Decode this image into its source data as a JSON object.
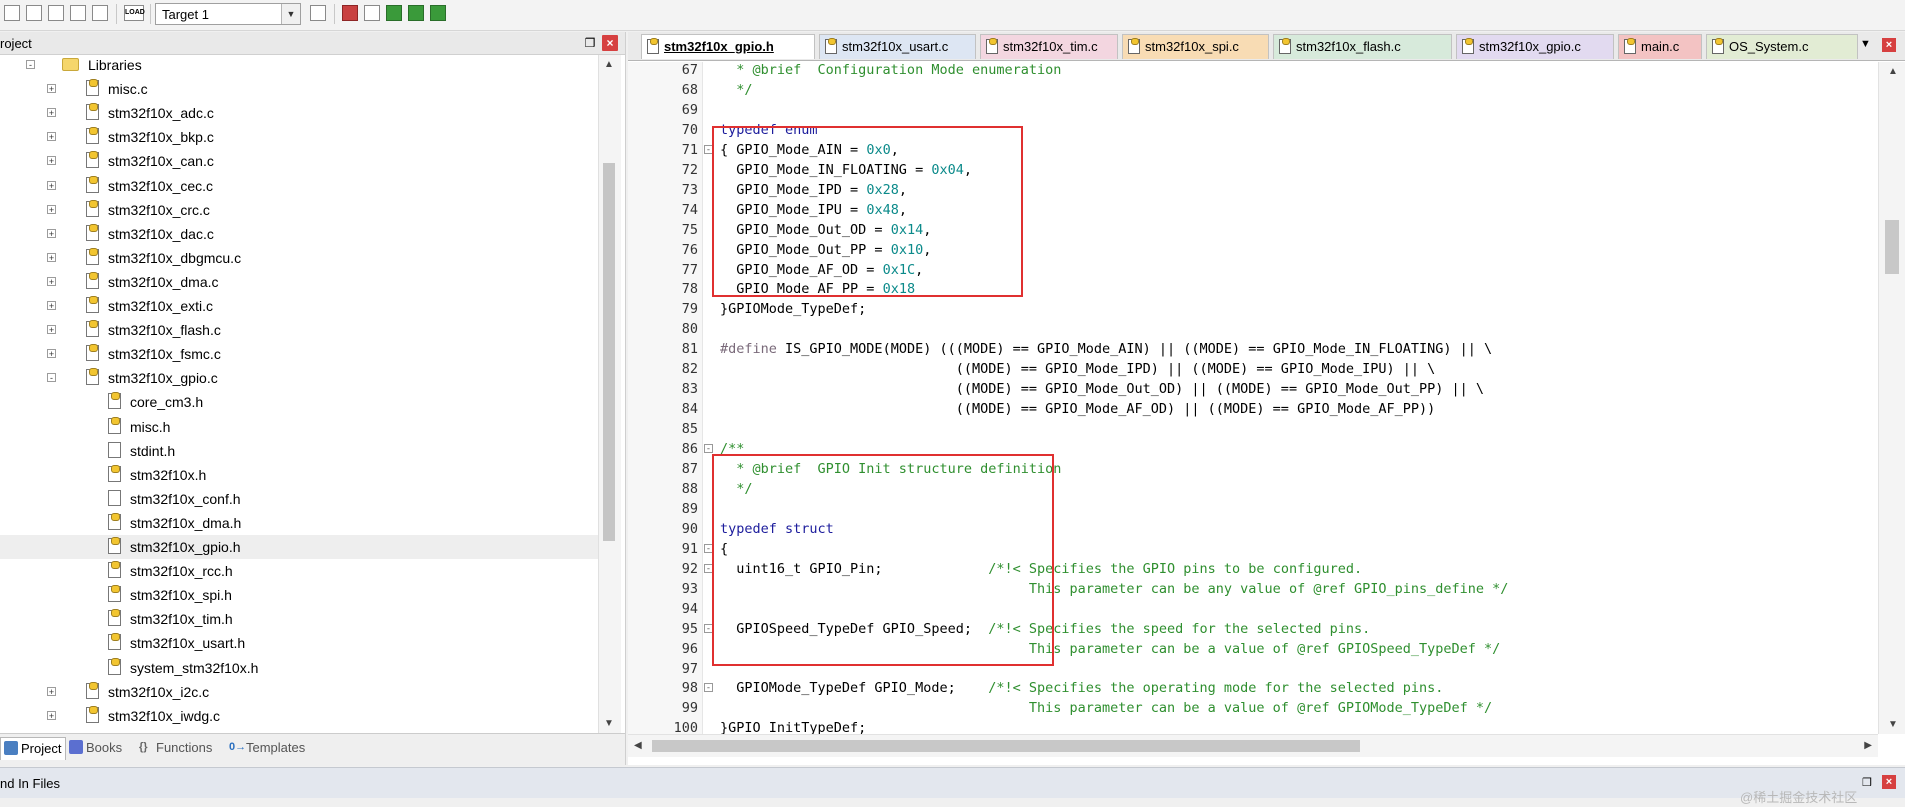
{
  "toolbar": {
    "target_label": "Target 1",
    "load_label": "LOAD"
  },
  "left_panel": {
    "title": "roject",
    "pin_glyph": "❒",
    "close_glyph": "×",
    "tree": [
      {
        "label": "Libraries",
        "type": "folder",
        "expander": "-",
        "level": 0
      },
      {
        "label": "misc.c",
        "type": "c",
        "expander": "+",
        "level": 1
      },
      {
        "label": "stm32f10x_adc.c",
        "type": "c",
        "expander": "+",
        "level": 1
      },
      {
        "label": "stm32f10x_bkp.c",
        "type": "c",
        "expander": "+",
        "level": 1
      },
      {
        "label": "stm32f10x_can.c",
        "type": "c",
        "expander": "+",
        "level": 1
      },
      {
        "label": "stm32f10x_cec.c",
        "type": "c",
        "expander": "+",
        "level": 1
      },
      {
        "label": "stm32f10x_crc.c",
        "type": "c",
        "expander": "+",
        "level": 1
      },
      {
        "label": "stm32f10x_dac.c",
        "type": "c",
        "expander": "+",
        "level": 1
      },
      {
        "label": "stm32f10x_dbgmcu.c",
        "type": "c",
        "expander": "+",
        "level": 1
      },
      {
        "label": "stm32f10x_dma.c",
        "type": "c",
        "expander": "+",
        "level": 1
      },
      {
        "label": "stm32f10x_exti.c",
        "type": "c",
        "expander": "+",
        "level": 1
      },
      {
        "label": "stm32f10x_flash.c",
        "type": "c",
        "expander": "+",
        "level": 1
      },
      {
        "label": "stm32f10x_fsmc.c",
        "type": "c",
        "expander": "+",
        "level": 1
      },
      {
        "label": "stm32f10x_gpio.c",
        "type": "c",
        "expander": "-",
        "level": 1
      },
      {
        "label": "core_cm3.h",
        "type": "c",
        "expander": "",
        "level": 2
      },
      {
        "label": "misc.h",
        "type": "c",
        "expander": "",
        "level": 2
      },
      {
        "label": "stdint.h",
        "type": "h",
        "expander": "",
        "level": 2
      },
      {
        "label": "stm32f10x.h",
        "type": "c",
        "expander": "",
        "level": 2
      },
      {
        "label": "stm32f10x_conf.h",
        "type": "h",
        "expander": "",
        "level": 2
      },
      {
        "label": "stm32f10x_dma.h",
        "type": "c",
        "expander": "",
        "level": 2
      },
      {
        "label": "stm32f10x_gpio.h",
        "type": "c",
        "expander": "",
        "level": 2,
        "selected": true
      },
      {
        "label": "stm32f10x_rcc.h",
        "type": "c",
        "expander": "",
        "level": 2
      },
      {
        "label": "stm32f10x_spi.h",
        "type": "c",
        "expander": "",
        "level": 2
      },
      {
        "label": "stm32f10x_tim.h",
        "type": "c",
        "expander": "",
        "level": 2
      },
      {
        "label": "stm32f10x_usart.h",
        "type": "c",
        "expander": "",
        "level": 2
      },
      {
        "label": "system_stm32f10x.h",
        "type": "c",
        "expander": "",
        "level": 2
      },
      {
        "label": "stm32f10x_i2c.c",
        "type": "c",
        "expander": "+",
        "level": 1
      },
      {
        "label": "stm32f10x_iwdg.c",
        "type": "c",
        "expander": "+",
        "level": 1
      }
    ],
    "bottom_tabs": [
      {
        "label": "Project",
        "icon_color": "#4a7fc1"
      },
      {
        "label": "Books",
        "icon_color": "#5b6fd0"
      },
      {
        "label": "Functions",
        "icon_color": "#666666",
        "glyph": "{}"
      },
      {
        "label": "Templates",
        "icon_color": "#2a6fbf",
        "glyph": "0→"
      }
    ]
  },
  "editor": {
    "tabs": [
      {
        "label": "stm32f10x_gpio.h",
        "active": true,
        "color": "#ffffff"
      },
      {
        "label": "stm32f10x_usart.c",
        "color": "#dde6f3"
      },
      {
        "label": "stm32f10x_tim.c",
        "color": "#f3d6e0"
      },
      {
        "label": "stm32f10x_spi.c",
        "color": "#f8dcb4"
      },
      {
        "label": "stm32f10x_flash.c",
        "color": "#d7eadb"
      },
      {
        "label": "stm32f10x_gpio.c",
        "color": "#e2daf0"
      },
      {
        "label": "main.c",
        "color": "#f3c3c3"
      },
      {
        "label": "OS_System.c",
        "color": "#e2ecd4"
      }
    ],
    "menu_glyph": "▼",
    "close_glyph": "×",
    "lines": [
      {
        "n": "67",
        "fold": "",
        "segs": [
          [
            "cm",
            "  * @brief  Configuration Mode enumeration"
          ]
        ]
      },
      {
        "n": "68",
        "fold": "",
        "segs": [
          [
            "cm",
            "  */"
          ]
        ]
      },
      {
        "n": "69",
        "fold": "",
        "segs": []
      },
      {
        "n": "70",
        "fold": "",
        "segs": [
          [
            "kw",
            "typedef enum"
          ]
        ]
      },
      {
        "n": "71",
        "fold": "-",
        "segs": [
          [
            "plain",
            "{ GPIO_Mode_AIN = "
          ],
          [
            "num",
            "0x0"
          ],
          [
            "plain",
            ","
          ]
        ]
      },
      {
        "n": "72",
        "fold": "",
        "segs": [
          [
            "plain",
            "  GPIO_Mode_IN_FLOATING = "
          ],
          [
            "num",
            "0x04"
          ],
          [
            "plain",
            ","
          ]
        ]
      },
      {
        "n": "73",
        "fold": "",
        "segs": [
          [
            "plain",
            "  GPIO_Mode_IPD = "
          ],
          [
            "num",
            "0x28"
          ],
          [
            "plain",
            ","
          ]
        ]
      },
      {
        "n": "74",
        "fold": "",
        "segs": [
          [
            "plain",
            "  GPIO_Mode_IPU = "
          ],
          [
            "num",
            "0x48"
          ],
          [
            "plain",
            ","
          ]
        ]
      },
      {
        "n": "75",
        "fold": "",
        "segs": [
          [
            "plain",
            "  GPIO_Mode_Out_OD = "
          ],
          [
            "num",
            "0x14"
          ],
          [
            "plain",
            ","
          ]
        ]
      },
      {
        "n": "76",
        "fold": "",
        "segs": [
          [
            "plain",
            "  GPIO_Mode_Out_PP = "
          ],
          [
            "num",
            "0x10"
          ],
          [
            "plain",
            ","
          ]
        ]
      },
      {
        "n": "77",
        "fold": "",
        "segs": [
          [
            "plain",
            "  GPIO_Mode_AF_OD = "
          ],
          [
            "num",
            "0x1C"
          ],
          [
            "plain",
            ","
          ]
        ]
      },
      {
        "n": "78",
        "fold": "",
        "segs": [
          [
            "plain",
            "  GPIO_Mode_AF_PP = "
          ],
          [
            "num",
            "0x18"
          ]
        ]
      },
      {
        "n": "79",
        "fold": "",
        "segs": [
          [
            "plain",
            "}GPIOMode_TypeDef;"
          ]
        ]
      },
      {
        "n": "80",
        "fold": "",
        "segs": []
      },
      {
        "n": "81",
        "fold": "",
        "segs": [
          [
            "pp",
            "#define "
          ],
          [
            "plain",
            "IS_GPIO_MODE(MODE) (((MODE) == GPIO_Mode_AIN) || ((MODE) == GPIO_Mode_IN_FLOATING) || \\"
          ]
        ]
      },
      {
        "n": "82",
        "fold": "",
        "segs": [
          [
            "plain",
            "                             ((MODE) == GPIO_Mode_IPD) || ((MODE) == GPIO_Mode_IPU) || \\"
          ]
        ]
      },
      {
        "n": "83",
        "fold": "",
        "segs": [
          [
            "plain",
            "                             ((MODE) == GPIO_Mode_Out_OD) || ((MODE) == GPIO_Mode_Out_PP) || \\"
          ]
        ]
      },
      {
        "n": "84",
        "fold": "",
        "segs": [
          [
            "plain",
            "                             ((MODE) == GPIO_Mode_AF_OD) || ((MODE) == GPIO_Mode_AF_PP))"
          ]
        ]
      },
      {
        "n": "85",
        "fold": "",
        "segs": []
      },
      {
        "n": "86",
        "fold": "-",
        "segs": [
          [
            "cm",
            "/**"
          ]
        ]
      },
      {
        "n": "87",
        "fold": "",
        "segs": [
          [
            "cm",
            "  * @brief  GPIO Init structure definition"
          ]
        ]
      },
      {
        "n": "88",
        "fold": "",
        "segs": [
          [
            "cm",
            "  */"
          ]
        ]
      },
      {
        "n": "89",
        "fold": "",
        "segs": []
      },
      {
        "n": "90",
        "fold": "",
        "segs": [
          [
            "kw",
            "typedef struct"
          ]
        ]
      },
      {
        "n": "91",
        "fold": "-",
        "segs": [
          [
            "plain",
            "{"
          ]
        ]
      },
      {
        "n": "92",
        "fold": "-",
        "segs": [
          [
            "plain",
            "  uint16_t GPIO_Pin;             "
          ],
          [
            "cm",
            "/*!< Specifies the GPIO pins to be configured."
          ]
        ]
      },
      {
        "n": "93",
        "fold": "",
        "segs": [
          [
            "cm",
            "                                      This parameter can be any value of @ref GPIO_pins_define */"
          ]
        ]
      },
      {
        "n": "94",
        "fold": "",
        "segs": []
      },
      {
        "n": "95",
        "fold": "-",
        "segs": [
          [
            "plain",
            "  GPIOSpeed_TypeDef GPIO_Speed;  "
          ],
          [
            "cm",
            "/*!< Specifies the speed for the selected pins."
          ]
        ]
      },
      {
        "n": "96",
        "fold": "",
        "segs": [
          [
            "cm",
            "                                      This parameter can be a value of @ref GPIOSpeed_TypeDef */"
          ]
        ]
      },
      {
        "n": "97",
        "fold": "",
        "segs": []
      },
      {
        "n": "98",
        "fold": "-",
        "segs": [
          [
            "plain",
            "  GPIOMode_TypeDef GPIO_Mode;    "
          ],
          [
            "cm",
            "/*!< Specifies the operating mode for the selected pins."
          ]
        ]
      },
      {
        "n": "99",
        "fold": "",
        "segs": [
          [
            "cm",
            "                                      This parameter can be a value of @ref GPIOMode_TypeDef */"
          ]
        ]
      },
      {
        "n": "100",
        "fold": "",
        "segs": [
          [
            "plain",
            "}GPIO_InitTypeDef;"
          ]
        ]
      }
    ]
  },
  "output": {
    "title": "nd In Files",
    "pin_glyph": "❒",
    "close_glyph": "×"
  },
  "watermark": "@稀土掘金技术社区",
  "colors": {
    "highlight_box": "#e03030",
    "keyword": "#1c1c9c",
    "number": "#0b8a8a",
    "comment": "#2f8f2f"
  }
}
